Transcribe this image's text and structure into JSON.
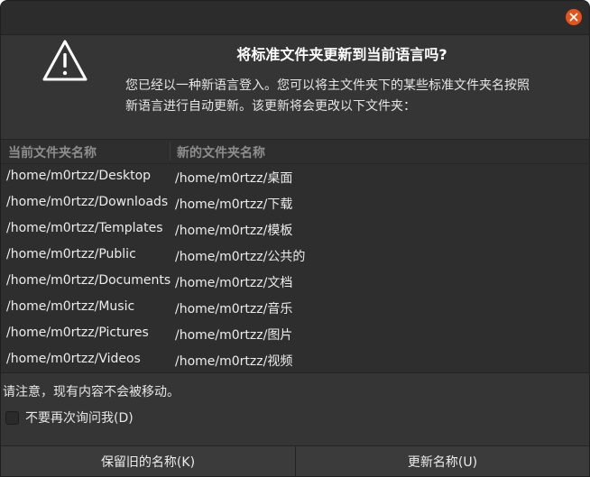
{
  "dialog": {
    "heading": "将标准文件夹更新到当前语言吗?",
    "description_lines": [
      "您已经以一种新语言登入。您可以将主文件夹下的某些标准文件夹名按照",
      "新语言进行自动更新。该更新将会更改以下文件夹："
    ],
    "icons": {
      "close": "close-icon",
      "warning": "warning-triangle-icon"
    },
    "accent_close": "#e5531a"
  },
  "table": {
    "headers": [
      "当前文件夹名称",
      "新的文件夹名称"
    ],
    "rows": [
      [
        "/home/m0rtzz/Desktop",
        "/home/m0rtzz/桌面"
      ],
      [
        "/home/m0rtzz/Downloads",
        "/home/m0rtzz/下载"
      ],
      [
        "/home/m0rtzz/Templates",
        "/home/m0rtzz/模板"
      ],
      [
        "/home/m0rtzz/Public",
        "/home/m0rtzz/公共的"
      ],
      [
        "/home/m0rtzz/Documents",
        "/home/m0rtzz/文档"
      ],
      [
        "/home/m0rtzz/Music",
        "/home/m0rtzz/音乐"
      ],
      [
        "/home/m0rtzz/Pictures",
        "/home/m0rtzz/图片"
      ],
      [
        "/home/m0rtzz/Videos",
        "/home/m0rtzz/视频"
      ]
    ]
  },
  "note": "请注意，现有内容不会被移动。",
  "dont_ask": {
    "label": "不要再次询问我(D)",
    "checked": false
  },
  "buttons": {
    "keep": "保留旧的名称(K)",
    "update": "更新名称(U)"
  }
}
